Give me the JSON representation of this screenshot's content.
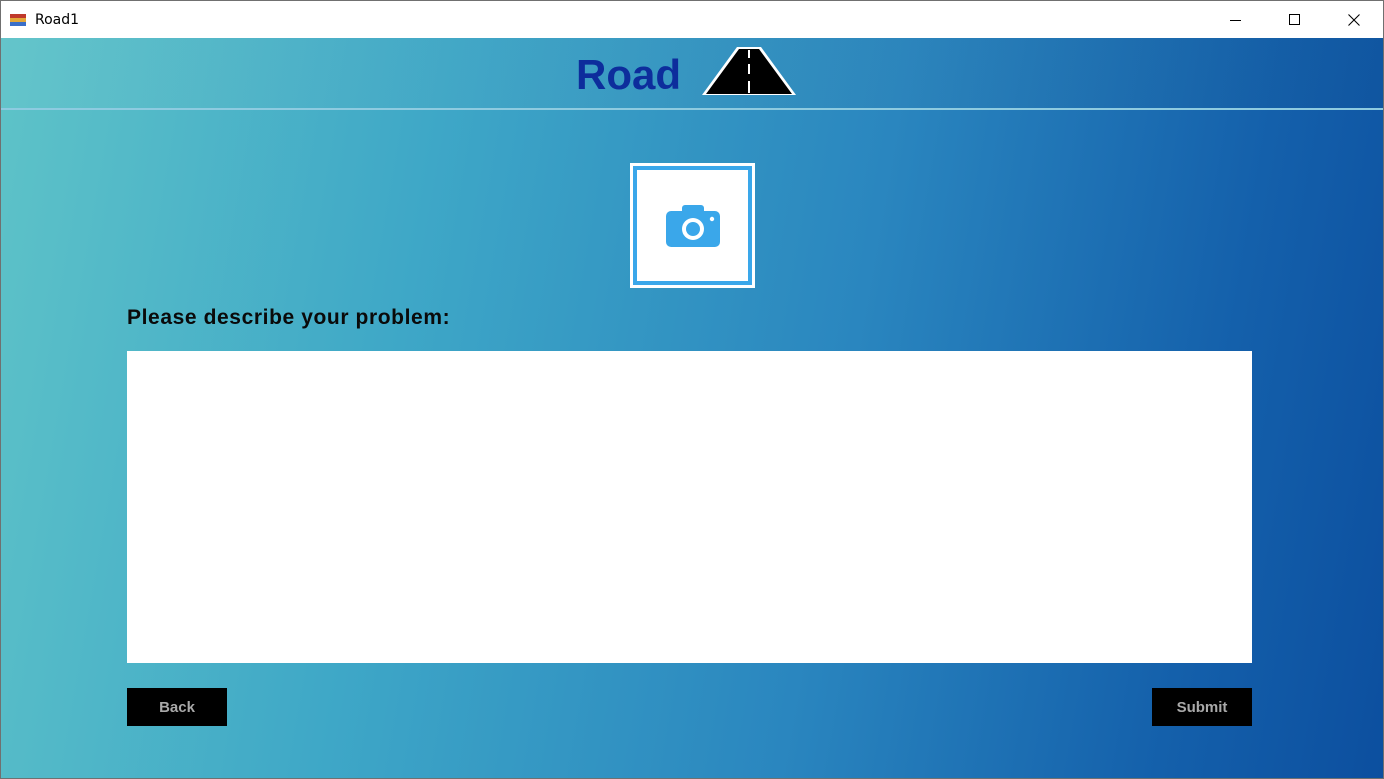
{
  "window": {
    "title": "Road1"
  },
  "header": {
    "brand": "Road"
  },
  "form": {
    "prompt": "Please describe your problem:",
    "description_value": "",
    "photo_icon": "camera-icon"
  },
  "actions": {
    "back_label": "Back",
    "submit_label": "Submit"
  },
  "colors": {
    "brand_text": "#0d2d9c",
    "photo_border": "#3aa7ea",
    "button_bg": "#000000",
    "button_text": "#a9a9a9"
  }
}
